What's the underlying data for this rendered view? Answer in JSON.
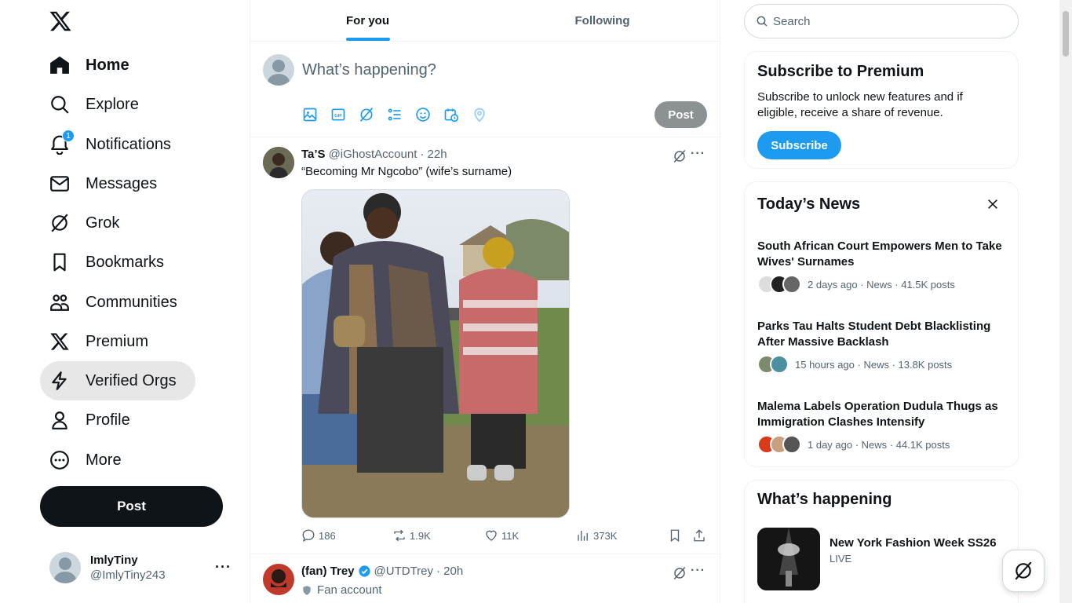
{
  "nav": {
    "items": [
      {
        "label": "Home",
        "icon": "home-icon"
      },
      {
        "label": "Explore",
        "icon": "search-icon"
      },
      {
        "label": "Notifications",
        "icon": "bell-icon",
        "badge": "1"
      },
      {
        "label": "Messages",
        "icon": "mail-icon"
      },
      {
        "label": "Grok",
        "icon": "grok-icon"
      },
      {
        "label": "Bookmarks",
        "icon": "bookmark-icon"
      },
      {
        "label": "Communities",
        "icon": "communities-icon"
      },
      {
        "label": "Premium",
        "icon": "x-logo-icon"
      },
      {
        "label": "Verified Orgs",
        "icon": "lightning-icon"
      },
      {
        "label": "Profile",
        "icon": "person-icon"
      },
      {
        "label": "More",
        "icon": "more-circle-icon"
      }
    ],
    "post_label": "Post"
  },
  "account": {
    "name": "ImlyTiny",
    "handle": "@ImlyTiny243"
  },
  "tabs": {
    "for_you": "For you",
    "following": "Following"
  },
  "composer": {
    "placeholder": "What’s happening?",
    "post_label": "Post"
  },
  "tweets": [
    {
      "name": "Ta’S",
      "handle": "@iGhostAccount",
      "time": "· 22h",
      "text": "“Becoming Mr Ngcobo” (wife’s surname)",
      "replies": "186",
      "reposts": "1.9K",
      "likes": "11K",
      "views": "373K"
    },
    {
      "name": "(fan) Trey",
      "handle": "@UTDTrey",
      "time": "· 20h",
      "text": "Fan account",
      "text_icon": "shield-icon"
    }
  ],
  "search": {
    "placeholder": "Search"
  },
  "premium": {
    "title": "Subscribe to Premium",
    "desc": "Subscribe to unlock new features and if eligible, receive a share of revenue.",
    "button": "Subscribe"
  },
  "news": {
    "title": "Today’s News",
    "items": [
      {
        "title": "South African Court Empowers Men to Take Wives' Surnames",
        "meta": "2 days ago · News · 41.5K posts"
      },
      {
        "title": "Parks Tau Halts Student Debt Blacklisting After Massive Backlash",
        "meta": "15 hours ago · News · 13.8K posts"
      },
      {
        "title": "Malema Labels Operation Dudula Thugs as Immigration Clashes Intensify",
        "meta": "1 day ago · News · 44.1K posts"
      }
    ]
  },
  "happening": {
    "title": "What’s happening",
    "item_title": "New York Fashion Week SS26",
    "item_sub": "LIVE"
  },
  "colors": {
    "accent": "#1d9bf0",
    "text": "#0f1419",
    "muted": "#536471"
  }
}
